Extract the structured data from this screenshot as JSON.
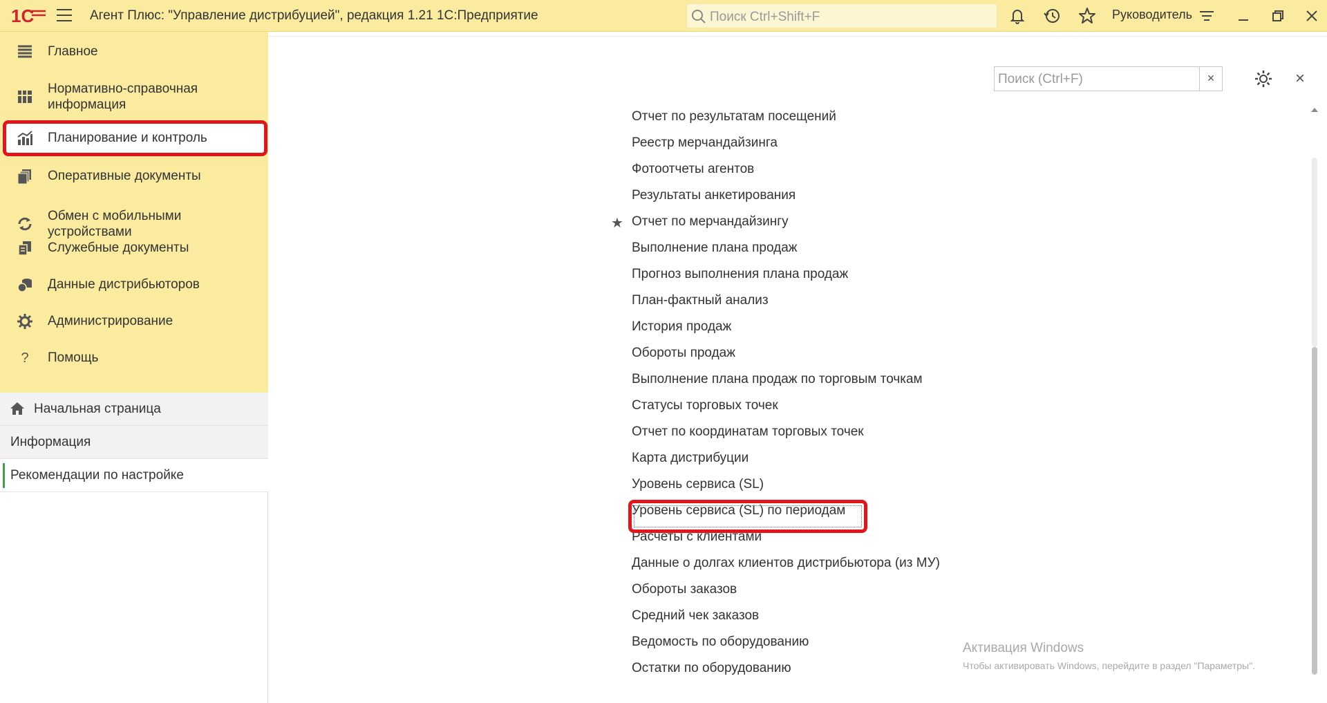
{
  "titlebar": {
    "title": "Агент Плюс: \"Управление дистрибуцией\", редакция 1.21 1С:Предприятие",
    "search_placeholder": "Поиск Ctrl+Shift+F",
    "user": "Руководитель",
    "bg_color": "#fbeb9f"
  },
  "sidebar": {
    "sections": [
      {
        "label": "Главное",
        "icon": "menu-list-icon"
      },
      {
        "label": "Нормативно-справочная информация",
        "icon": "catalog-icon"
      },
      {
        "label": "Планирование и контроль",
        "icon": "chart-bars-icon"
      },
      {
        "label": "Оперативные документы",
        "icon": "documents-icon"
      },
      {
        "label": "Обмен с мобильными устройствами",
        "icon": "sync-icon"
      },
      {
        "label": "Служебные документы",
        "icon": "service-docs-icon"
      },
      {
        "label": "Данные дистрибьюторов",
        "icon": "distributor-data-icon"
      },
      {
        "label": "Администрирование",
        "icon": "gear-icon"
      },
      {
        "label": "Помощь",
        "icon": "help-icon"
      }
    ],
    "nav": [
      {
        "label": "Начальная страница",
        "icon": "home-icon"
      },
      {
        "label": "Информация"
      },
      {
        "label": "Рекомендации по настройке"
      }
    ]
  },
  "main": {
    "search_placeholder": "Поиск (Ctrl+F)",
    "clear_label": "×",
    "close_label": "×",
    "reports": [
      "Отчет по результатам посещений",
      "Реестр мерчандайзинга",
      "Фотоотчеты агентов",
      "Результаты анкетирования",
      "Отчет по  мерчандайзингу",
      "Выполнение плана продаж",
      "Прогноз выполнения плана продаж",
      "План-фактный анализ",
      "История продаж",
      "Обороты продаж",
      "Выполнение плана продаж по торговым точкам",
      "Статусы торговых точек",
      "Отчет по координатам торговых точек",
      "Карта дистрибуции",
      "Уровень сервиса (SL)",
      "Уровень сервиса (SL) по периодам",
      "Расчеты с клиентами",
      "Данные о долгах клиентов дистрибьютора (из МУ)",
      "Обороты заказов",
      "Средний чек заказов",
      "Ведомость по оборудованию",
      "Остатки по оборудованию"
    ],
    "favorite_star": "★"
  },
  "watermark": {
    "line1": "Активация Windows",
    "line2": "Чтобы активировать Windows, перейдите в раздел \"Параметры\"."
  }
}
